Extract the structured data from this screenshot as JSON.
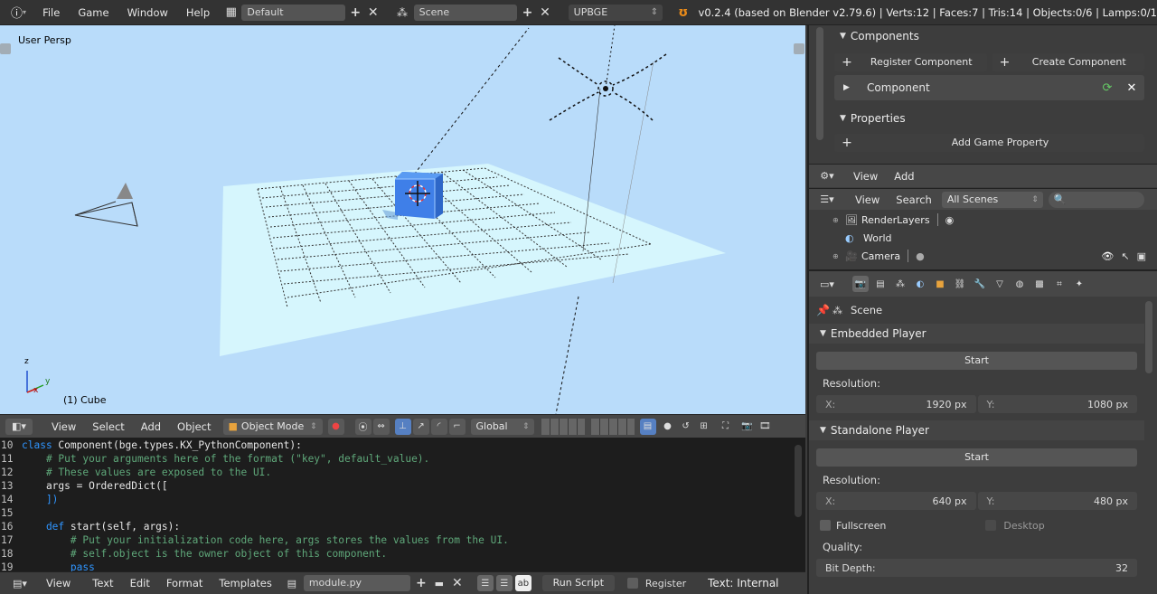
{
  "topbar": {
    "menus": [
      "File",
      "Game",
      "Window",
      "Help"
    ],
    "layout": "Default",
    "scene": "Scene",
    "engine": "UPBGE",
    "info": "v0.2.4 (based on Blender v2.79.6) | Verts:12 | Faces:7 | Tris:14 | Objects:0/6 | Lamps:0/1"
  },
  "viewport": {
    "view_label": "User Persp",
    "object_label": "(1) Cube",
    "axis_x": "x",
    "axis_y": "y",
    "axis_z": "z"
  },
  "vp_header": {
    "menus": [
      "View",
      "Select",
      "Add",
      "Object"
    ],
    "mode": "Object Mode",
    "orientation": "Global"
  },
  "editor": {
    "lines": [
      {
        "n": "10",
        "parts": [
          {
            "t": "class ",
            "c": "kw"
          },
          {
            "t": "Component(bge.types.KX_PythonComponent):",
            "c": "code"
          }
        ]
      },
      {
        "n": "11",
        "parts": [
          {
            "t": "    # Put your arguments here of the format (\"key\", default_value).",
            "c": "cm"
          }
        ]
      },
      {
        "n": "12",
        "parts": [
          {
            "t": "    # These values are exposed to the UI.",
            "c": "cm"
          }
        ]
      },
      {
        "n": "13",
        "parts": [
          {
            "t": "    args = OrderedDict([",
            "c": "code"
          }
        ]
      },
      {
        "n": "14",
        "parts": [
          {
            "t": "    ])",
            "c": "kw"
          }
        ]
      },
      {
        "n": "15",
        "parts": [
          {
            "t": "",
            "c": "code"
          }
        ]
      },
      {
        "n": "16",
        "parts": [
          {
            "t": "    def ",
            "c": "kw"
          },
          {
            "t": "start(self, args):",
            "c": "code"
          }
        ]
      },
      {
        "n": "17",
        "parts": [
          {
            "t": "        # Put your initialization code here, args stores the values from the UI.",
            "c": "cm"
          }
        ]
      },
      {
        "n": "18",
        "parts": [
          {
            "t": "        # self.object is the owner object of this component.",
            "c": "cm"
          }
        ]
      },
      {
        "n": "19",
        "parts": [
          {
            "t": "        pass",
            "c": "kw"
          }
        ]
      }
    ]
  },
  "te_footer": {
    "menus": [
      "View",
      "Text",
      "Edit",
      "Format",
      "Templates"
    ],
    "file": "module.py",
    "run_script": "Run Script",
    "register": "Register",
    "status": "Text: Internal"
  },
  "logic": {
    "components_title": "Components",
    "register_component": "Register Component",
    "create_component": "Create Component",
    "component_name": "Component",
    "properties_title": "Properties",
    "add_property": "Add Game Property"
  },
  "outliner": {
    "view": "View",
    "add": "Add",
    "search_menu": "Search",
    "scenes": "All Scenes",
    "items": [
      "RenderLayers",
      "World",
      "Camera"
    ]
  },
  "properties": {
    "breadcrumb": "Scene",
    "embedded_title": "Embedded Player",
    "start": "Start",
    "resolution": "Resolution:",
    "emb_x_label": "X:",
    "emb_x": "1920 px",
    "emb_y_label": "Y:",
    "emb_y": "1080 px",
    "standalone_title": "Standalone Player",
    "sa_x_label": "X:",
    "sa_x": "640 px",
    "sa_y_label": "Y:",
    "sa_y": "480 px",
    "fullscreen": "Fullscreen",
    "desktop": "Desktop",
    "quality": "Quality:",
    "bit_depth_label": "Bit Depth:",
    "bit_depth": "32"
  }
}
